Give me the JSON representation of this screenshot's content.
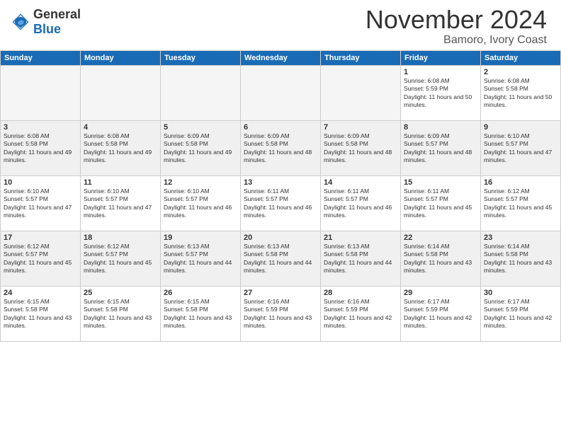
{
  "header": {
    "logo_general": "General",
    "logo_blue": "Blue",
    "month_title": "November 2024",
    "location": "Bamoro, Ivory Coast"
  },
  "days_of_week": [
    "Sunday",
    "Monday",
    "Tuesday",
    "Wednesday",
    "Thursday",
    "Friday",
    "Saturday"
  ],
  "weeks": [
    [
      {
        "day": "",
        "empty": true
      },
      {
        "day": "",
        "empty": true
      },
      {
        "day": "",
        "empty": true
      },
      {
        "day": "",
        "empty": true
      },
      {
        "day": "",
        "empty": true
      },
      {
        "day": "1",
        "sunrise": "Sunrise: 6:08 AM",
        "sunset": "Sunset: 5:59 PM",
        "daylight": "Daylight: 11 hours and 50 minutes."
      },
      {
        "day": "2",
        "sunrise": "Sunrise: 6:08 AM",
        "sunset": "Sunset: 5:58 PM",
        "daylight": "Daylight: 11 hours and 50 minutes."
      }
    ],
    [
      {
        "day": "3",
        "sunrise": "Sunrise: 6:08 AM",
        "sunset": "Sunset: 5:58 PM",
        "daylight": "Daylight: 11 hours and 49 minutes."
      },
      {
        "day": "4",
        "sunrise": "Sunrise: 6:08 AM",
        "sunset": "Sunset: 5:58 PM",
        "daylight": "Daylight: 11 hours and 49 minutes."
      },
      {
        "day": "5",
        "sunrise": "Sunrise: 6:09 AM",
        "sunset": "Sunset: 5:58 PM",
        "daylight": "Daylight: 11 hours and 49 minutes."
      },
      {
        "day": "6",
        "sunrise": "Sunrise: 6:09 AM",
        "sunset": "Sunset: 5:58 PM",
        "daylight": "Daylight: 11 hours and 48 minutes."
      },
      {
        "day": "7",
        "sunrise": "Sunrise: 6:09 AM",
        "sunset": "Sunset: 5:58 PM",
        "daylight": "Daylight: 11 hours and 48 minutes."
      },
      {
        "day": "8",
        "sunrise": "Sunrise: 6:09 AM",
        "sunset": "Sunset: 5:57 PM",
        "daylight": "Daylight: 11 hours and 48 minutes."
      },
      {
        "day": "9",
        "sunrise": "Sunrise: 6:10 AM",
        "sunset": "Sunset: 5:57 PM",
        "daylight": "Daylight: 11 hours and 47 minutes."
      }
    ],
    [
      {
        "day": "10",
        "sunrise": "Sunrise: 6:10 AM",
        "sunset": "Sunset: 5:57 PM",
        "daylight": "Daylight: 11 hours and 47 minutes."
      },
      {
        "day": "11",
        "sunrise": "Sunrise: 6:10 AM",
        "sunset": "Sunset: 5:57 PM",
        "daylight": "Daylight: 11 hours and 47 minutes."
      },
      {
        "day": "12",
        "sunrise": "Sunrise: 6:10 AM",
        "sunset": "Sunset: 5:57 PM",
        "daylight": "Daylight: 11 hours and 46 minutes."
      },
      {
        "day": "13",
        "sunrise": "Sunrise: 6:11 AM",
        "sunset": "Sunset: 5:57 PM",
        "daylight": "Daylight: 11 hours and 46 minutes."
      },
      {
        "day": "14",
        "sunrise": "Sunrise: 6:11 AM",
        "sunset": "Sunset: 5:57 PM",
        "daylight": "Daylight: 11 hours and 46 minutes."
      },
      {
        "day": "15",
        "sunrise": "Sunrise: 6:11 AM",
        "sunset": "Sunset: 5:57 PM",
        "daylight": "Daylight: 11 hours and 45 minutes."
      },
      {
        "day": "16",
        "sunrise": "Sunrise: 6:12 AM",
        "sunset": "Sunset: 5:57 PM",
        "daylight": "Daylight: 11 hours and 45 minutes."
      }
    ],
    [
      {
        "day": "17",
        "sunrise": "Sunrise: 6:12 AM",
        "sunset": "Sunset: 5:57 PM",
        "daylight": "Daylight: 11 hours and 45 minutes."
      },
      {
        "day": "18",
        "sunrise": "Sunrise: 6:12 AM",
        "sunset": "Sunset: 5:57 PM",
        "daylight": "Daylight: 11 hours and 45 minutes."
      },
      {
        "day": "19",
        "sunrise": "Sunrise: 6:13 AM",
        "sunset": "Sunset: 5:57 PM",
        "daylight": "Daylight: 11 hours and 44 minutes."
      },
      {
        "day": "20",
        "sunrise": "Sunrise: 6:13 AM",
        "sunset": "Sunset: 5:58 PM",
        "daylight": "Daylight: 11 hours and 44 minutes."
      },
      {
        "day": "21",
        "sunrise": "Sunrise: 6:13 AM",
        "sunset": "Sunset: 5:58 PM",
        "daylight": "Daylight: 11 hours and 44 minutes."
      },
      {
        "day": "22",
        "sunrise": "Sunrise: 6:14 AM",
        "sunset": "Sunset: 5:58 PM",
        "daylight": "Daylight: 11 hours and 43 minutes."
      },
      {
        "day": "23",
        "sunrise": "Sunrise: 6:14 AM",
        "sunset": "Sunset: 5:58 PM",
        "daylight": "Daylight: 11 hours and 43 minutes."
      }
    ],
    [
      {
        "day": "24",
        "sunrise": "Sunrise: 6:15 AM",
        "sunset": "Sunset: 5:58 PM",
        "daylight": "Daylight: 11 hours and 43 minutes."
      },
      {
        "day": "25",
        "sunrise": "Sunrise: 6:15 AM",
        "sunset": "Sunset: 5:58 PM",
        "daylight": "Daylight: 11 hours and 43 minutes."
      },
      {
        "day": "26",
        "sunrise": "Sunrise: 6:15 AM",
        "sunset": "Sunset: 5:58 PM",
        "daylight": "Daylight: 11 hours and 43 minutes."
      },
      {
        "day": "27",
        "sunrise": "Sunrise: 6:16 AM",
        "sunset": "Sunset: 5:59 PM",
        "daylight": "Daylight: 11 hours and 43 minutes."
      },
      {
        "day": "28",
        "sunrise": "Sunrise: 6:16 AM",
        "sunset": "Sunset: 5:59 PM",
        "daylight": "Daylight: 11 hours and 42 minutes."
      },
      {
        "day": "29",
        "sunrise": "Sunrise: 6:17 AM",
        "sunset": "Sunset: 5:59 PM",
        "daylight": "Daylight: 11 hours and 42 minutes."
      },
      {
        "day": "30",
        "sunrise": "Sunrise: 6:17 AM",
        "sunset": "Sunset: 5:59 PM",
        "daylight": "Daylight: 11 hours and 42 minutes."
      }
    ]
  ]
}
